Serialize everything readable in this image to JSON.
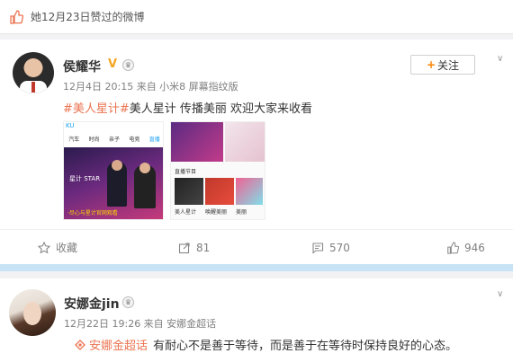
{
  "header": {
    "title": "她12月23日赞过的微博",
    "icon": "thumbs-up-icon"
  },
  "post1": {
    "author": "侯耀华",
    "verified_mark": "V",
    "meta": "12月4日 20:15 来自 小米8 屏幕指纹版",
    "follow_label": "关注",
    "hashtag": "#美人星计#",
    "body": "美人星计 传播美丽 欢迎大家来收看",
    "image1": {
      "app": "KU",
      "tabs": [
        "汽车",
        "时尚",
        "亲子",
        "电竞",
        "直播"
      ],
      "star_text": "星计 STAR",
      "caption": "·尽心与星计官网观看"
    },
    "image2": {
      "section_label": "直播节目",
      "item_labels": [
        "美人星计",
        "唤醒美丽",
        "美丽"
      ]
    },
    "actions": {
      "favorite": "收藏",
      "repost": "81",
      "comment": "570",
      "like": "946"
    }
  },
  "post2": {
    "author": "安娜金jin",
    "meta": "12月22日 19:26 来自 安娜金超话",
    "super_tag": "安娜金超话",
    "body": "有耐心不是善于等待，而是善于在等待时保持良好的心态。"
  },
  "colors": {
    "accent": "#ff8200",
    "tag": "#eb7350",
    "strip": "#c8e3f6"
  }
}
